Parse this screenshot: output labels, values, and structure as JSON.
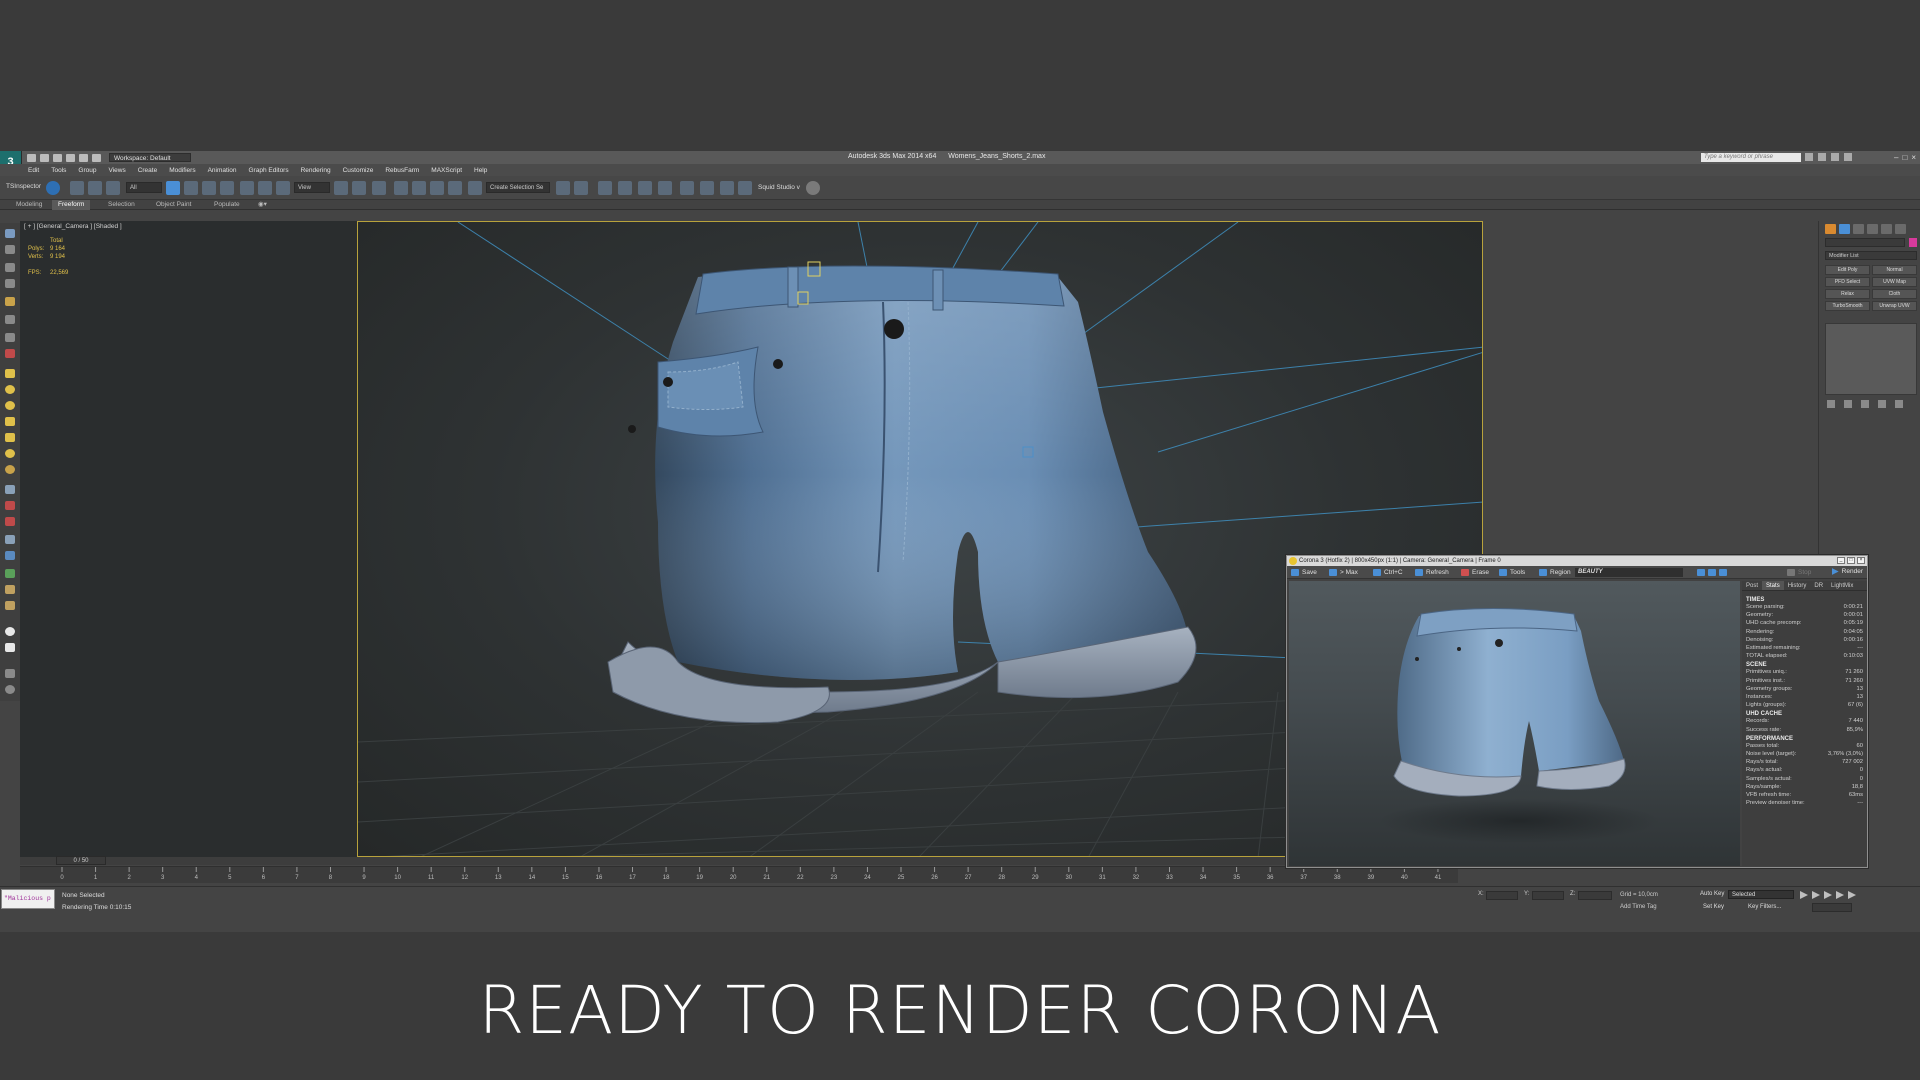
{
  "app": {
    "workspace": "Workspace: Default",
    "title_app": "Autodesk 3ds Max 2014 x64",
    "title_file": "Womens_Jeans_Shorts_2.max",
    "search_placeholder": "Type a keyword or phrase"
  },
  "menu": [
    "Edit",
    "Tools",
    "Group",
    "Views",
    "Create",
    "Modifiers",
    "Animation",
    "Graph Editors",
    "Rendering",
    "Customize",
    "RebusFarm",
    "MAXScript",
    "Help"
  ],
  "toolbar": {
    "tsinspector": "TSInspector",
    "filter_all": "All",
    "ref_coord": "View",
    "create_selection": "Create Selection Se",
    "squid": "Squid Studio v"
  },
  "ribbon_tabs": [
    "Modeling",
    "Freeform",
    "Selection",
    "Object Paint",
    "Populate"
  ],
  "ribbon_active": "Freeform",
  "viewport": {
    "label": "[ + ] [General_Camera ] [Shaded ]",
    "stats": {
      "total": "Total",
      "polys_label": "Polys:",
      "polys": "9 164",
      "verts_label": "Verts:",
      "verts": "9 194",
      "fps_label": "FPS:",
      "fps": "22,569"
    }
  },
  "modifier_panel": {
    "list": "Modifier List",
    "buttons": [
      "Edit Poly",
      "Normal",
      "PFD Select",
      "UVW Map",
      "Relax",
      "Cloth",
      "TurboSmooth",
      "Unwrap UVW"
    ]
  },
  "timeline": {
    "slider": "0 / 50",
    "ticks": [
      "0",
      "1",
      "2",
      "3",
      "4",
      "5",
      "6",
      "7",
      "8",
      "9",
      "10",
      "11",
      "12",
      "13",
      "14",
      "15",
      "16",
      "17",
      "18",
      "19",
      "20",
      "21",
      "22",
      "23",
      "24",
      "25",
      "26",
      "27",
      "28",
      "29",
      "30",
      "31",
      "32",
      "33",
      "34",
      "35",
      "36",
      "37",
      "38",
      "39",
      "40",
      "41",
      "42",
      "43",
      "44",
      "45",
      "46",
      "47",
      "48",
      "49",
      "50"
    ]
  },
  "status": {
    "maxscript": "\"Malicious p",
    "selection": "None Selected",
    "render_time": "Rendering Time  0:10:15",
    "x_label": "X:",
    "y_label": "Y:",
    "z_label": "Z:",
    "grid": "Grid = 10,0cm",
    "add_time_tag": "Add Time Tag",
    "auto_key": "Auto Key",
    "set_key": "Set Key",
    "selected": "Selected",
    "key_filters": "Key Filters..."
  },
  "vfb": {
    "title": "Corona 3 (Hotfix 2) | 800x450px (1:1) | Camera: General_Camera | Frame 0",
    "toolbar": {
      "save": "Save",
      "to_max": "> Max",
      "ctrlc": "Ctrl+C",
      "refresh": "Refresh",
      "erase": "Erase",
      "tools": "Tools",
      "region": "Region",
      "beauty": "BEAUTY",
      "stop": "Stop",
      "render": "Render"
    },
    "tabs": [
      "Post",
      "Stats",
      "History",
      "DR",
      "LightMix"
    ],
    "active_tab": "Stats",
    "sections": [
      {
        "head": "TIMES",
        "rows": [
          [
            "Scene parsing:",
            "0:00:21"
          ],
          [
            "Geometry:",
            "0:00:01"
          ],
          [
            "UHD cache precomp:",
            "0:05:19"
          ],
          [
            "Rendering:",
            "0:04:05"
          ],
          [
            "Denoising:",
            "0:00:16"
          ],
          [
            "Estimated remaining:",
            "---"
          ],
          [
            "TOTAL elapsed:",
            "0:10:03"
          ]
        ]
      },
      {
        "head": "SCENE",
        "rows": [
          [
            "Primitives uniq.:",
            "71 260"
          ],
          [
            "Primitives inst.:",
            "71 260"
          ],
          [
            "Geometry groups:",
            "13"
          ],
          [
            "Instances:",
            "13"
          ],
          [
            "Lights (groups):",
            "67 (6)"
          ]
        ]
      },
      {
        "head": "UHD CACHE",
        "rows": [
          [
            "Records:",
            "7 440"
          ],
          [
            "Success rate:",
            "85,9%"
          ]
        ]
      },
      {
        "head": "PERFORMANCE",
        "rows": [
          [
            "Passes total:",
            "60"
          ],
          [
            "Noise level (target):",
            "3,76% (3,0%)"
          ],
          [
            "Rays/s total:",
            "727 002"
          ],
          [
            "Rays/s actual:",
            "0"
          ],
          [
            "Samples/s actual:",
            "0"
          ],
          [
            "Rays/sample:",
            "18,8"
          ],
          [
            "VFB refresh time:",
            "63ms"
          ],
          [
            "Preview denoiser time:",
            "---"
          ]
        ]
      }
    ]
  },
  "caption": "READY TO RENDER  CORONA",
  "colors": {
    "safe_frame": "#b8a23c",
    "stats_text": "#e0c04a",
    "denim_light": "#7a9fc2",
    "denim_dark": "#3f5a78",
    "cuff": "#9aa6b6",
    "helper_lines": "#3f8fc0"
  }
}
